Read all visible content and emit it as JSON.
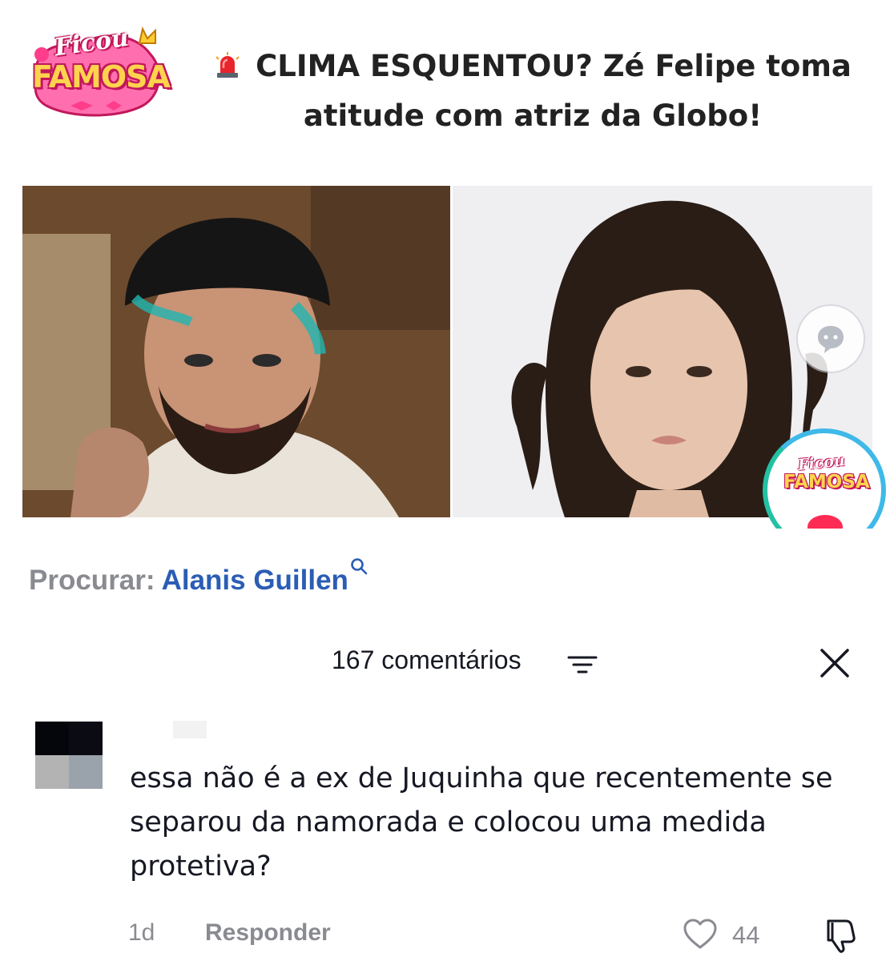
{
  "post": {
    "logo_top": "Ficou",
    "logo_bottom": "FAMOSA",
    "siren_icon": "siren-emoji",
    "headline_line1": "CLIMA ESQUENTOU? Zé Felipe toma",
    "headline_line2": "atitude com atriz da Globo!",
    "badge_top": "Ficou",
    "badge_bottom": "FAMOSA"
  },
  "search": {
    "prefix": "Procurar:",
    "term": "Alanis Guillen"
  },
  "comments": {
    "count_label": "167 comentários",
    "items": [
      {
        "text": "essa não é a ex de Juquinha que recentemente se separou da namorada e colocou uma medida protetiva?",
        "age": "1d",
        "reply_label": "Responder",
        "likes": "44"
      }
    ]
  },
  "colors": {
    "link_blue": "#2b5db5",
    "muted_gray": "#8a8b91",
    "text": "#161823",
    "brand_pink": "#c2185b",
    "brand_yellow": "#ffd34d"
  }
}
